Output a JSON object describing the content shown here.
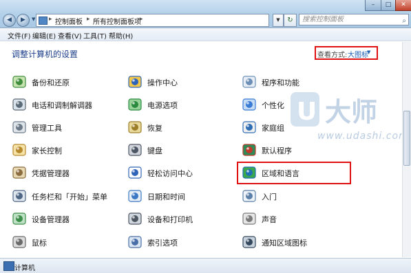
{
  "window": {
    "breadcrumb": [
      "控制面板",
      "所有控制面板项"
    ],
    "search_placeholder": "搜索控制面板",
    "controls": {
      "minimize": "–",
      "maximize": "□",
      "close": "✕"
    }
  },
  "menubar": [
    "文件(F)",
    "编辑(E)",
    "查看(V)",
    "工具(T)",
    "帮助(H)"
  ],
  "content": {
    "heading": "调整计算机的设置",
    "view_label": "查看方式:",
    "view_value": "大图标"
  },
  "items": [
    [
      "备份和还原",
      "操作中心",
      "程序和功能"
    ],
    [
      "电话和调制解调器",
      "电源选项",
      "个性化"
    ],
    [
      "管理工具",
      "恢复",
      "家庭组"
    ],
    [
      "家长控制",
      "键盘",
      "默认程序"
    ],
    [
      "凭据管理器",
      "轻松访问中心",
      "区域和语言"
    ],
    [
      "任务栏和「开始」菜单",
      "日期和时间",
      "入门"
    ],
    [
      "设备管理器",
      "设备和打印机",
      "声音"
    ],
    [
      "鼠标",
      "索引选项",
      "通知区域图标"
    ]
  ],
  "icon_names": [
    [
      "backup-icon",
      "action-center-flag-icon",
      "programs-icon"
    ],
    [
      "phone-modem-icon",
      "power-options-icon",
      "personalization-icon"
    ],
    [
      "admin-tools-icon",
      "recovery-icon",
      "homegroup-icon"
    ],
    [
      "parental-controls-icon",
      "keyboard-icon",
      "default-programs-icon"
    ],
    [
      "credential-manager-icon",
      "ease-of-access-icon",
      "region-language-globe-icon"
    ],
    [
      "taskbar-icon",
      "date-time-icon",
      "getting-started-icon"
    ],
    [
      "device-manager-icon",
      "devices-printers-icon",
      "sound-icon"
    ],
    [
      "mouse-icon",
      "indexing-options-icon",
      "notification-area-icon"
    ]
  ],
  "status": {
    "text": "计算机"
  },
  "watermark": {
    "url": "www.udashi.com",
    "brand": "U大师"
  }
}
